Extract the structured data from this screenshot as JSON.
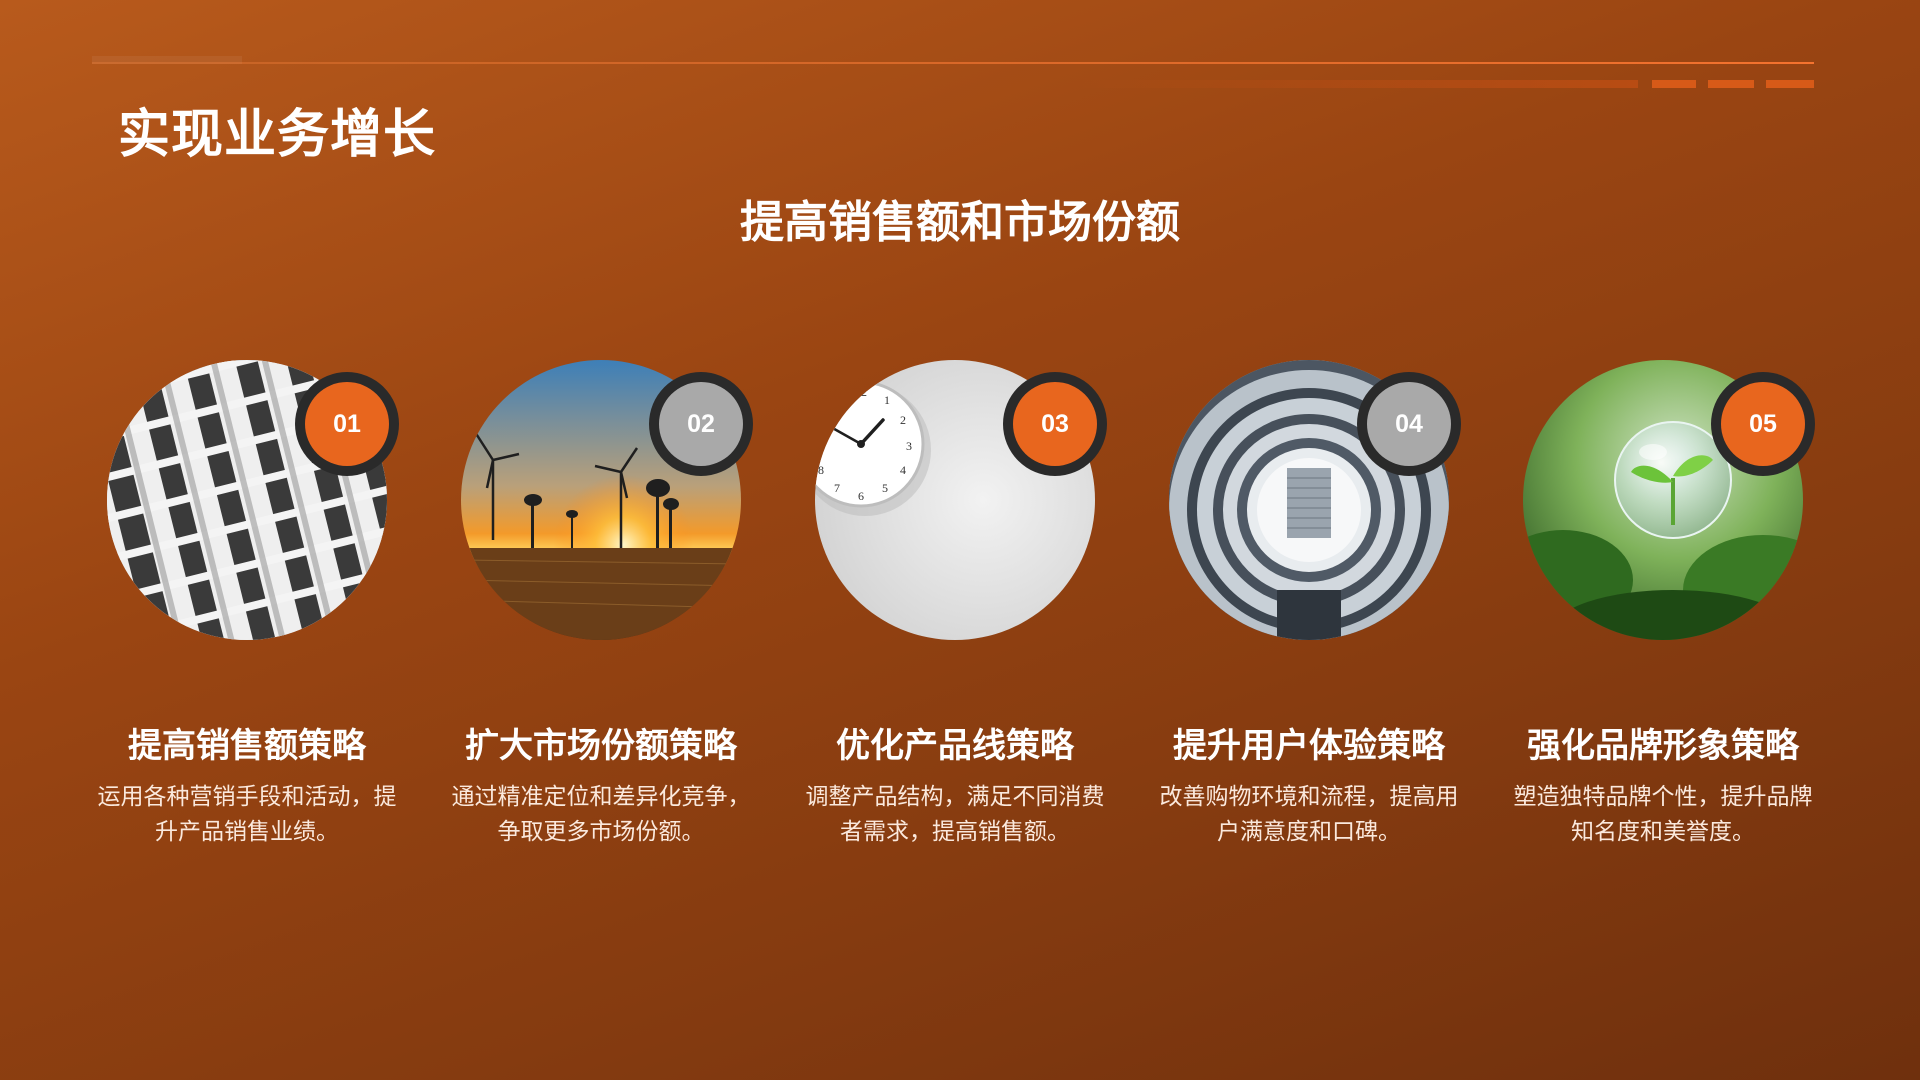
{
  "header": {
    "title": "实现业务增长",
    "subtitle": "提高销售额和市场份额"
  },
  "cards": [
    {
      "number": "01",
      "title": "提高销售额策略",
      "description": "运用各种营销手段和活动，提升产品销售业绩。",
      "badge_style": "orange",
      "image": "apartment-building-facade"
    },
    {
      "number": "02",
      "title": "扩大市场份额策略",
      "description": "通过精准定位和差异化竞争，争取更多市场份额。",
      "badge_style": "gray",
      "image": "wind-turbines-sunset"
    },
    {
      "number": "03",
      "title": "优化产品线策略",
      "description": "调整产品结构，满足不同消费者需求，提高销售额。",
      "badge_style": "orange",
      "image": "wall-clock"
    },
    {
      "number": "04",
      "title": "提升用户体验策略",
      "description": "改善购物环境和流程，提高用户满意度和口碑。",
      "badge_style": "gray",
      "image": "circular-building-atrium"
    },
    {
      "number": "05",
      "title": "强化品牌形象策略",
      "description": "塑造独特品牌个性，提升品牌知名度和美誉度。",
      "badge_style": "orange",
      "image": "sprout-in-glass-sphere"
    }
  ],
  "colors": {
    "accent": "#e8661e",
    "badge_gray": "#a9a9a9",
    "background": "#9a4512"
  }
}
